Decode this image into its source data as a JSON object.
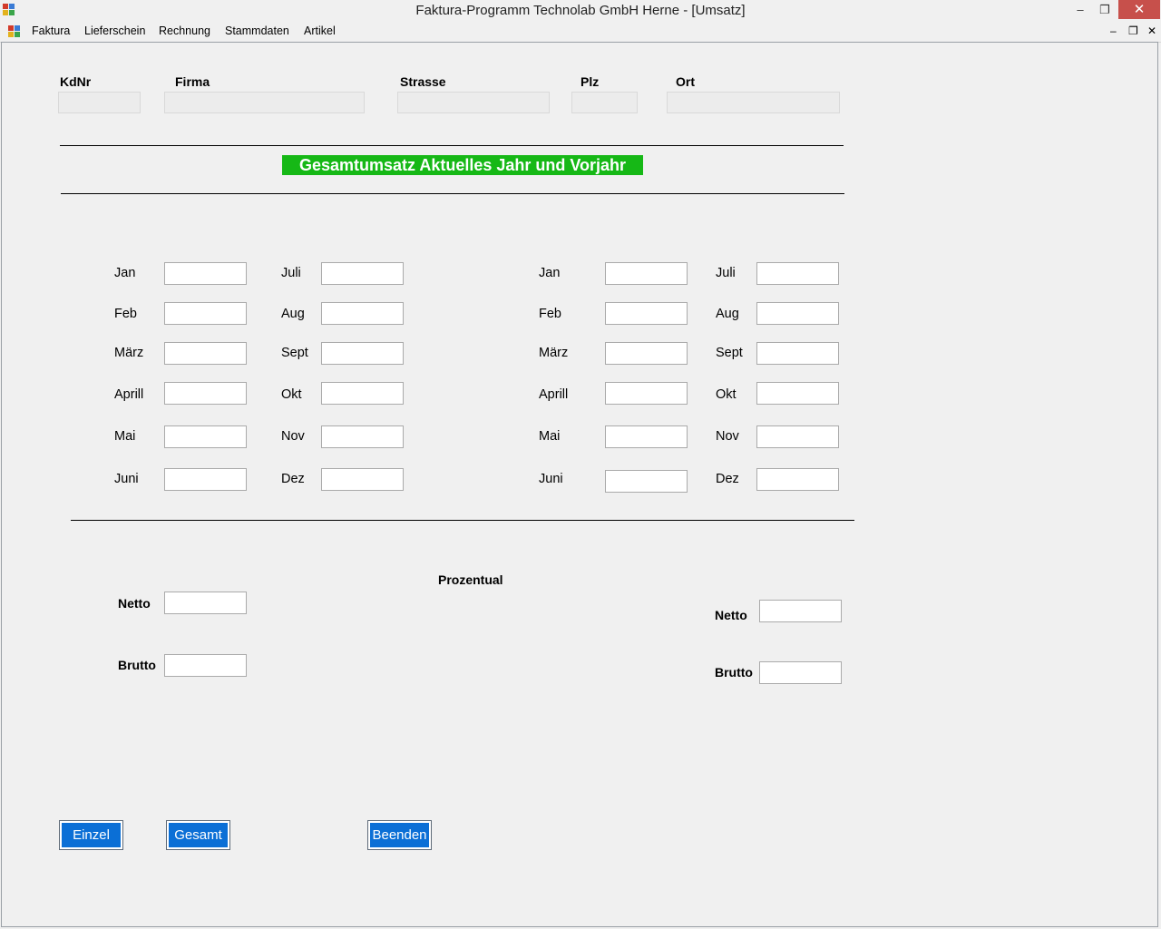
{
  "window": {
    "title": "Faktura-Programm Technolab GmbH Herne - [Umsatz]",
    "minimize": "–",
    "maximize": "❐",
    "close": "✕"
  },
  "menu": {
    "items": [
      "Faktura",
      "Lieferschein",
      "Rechnung",
      "Stammdaten",
      "Artikel"
    ],
    "mdi_minimize": "–",
    "mdi_restore": "❐",
    "mdi_close": "✕"
  },
  "header": {
    "kdnr_label": "KdNr",
    "firma_label": "Firma",
    "strasse_label": "Strasse",
    "plz_label": "Plz",
    "ort_label": "Ort"
  },
  "banner": "Gesamtumsatz Aktuelles Jahr und Vorjahr",
  "months_left": [
    "Jan",
    "Feb",
    "März",
    "Aprill",
    "Mai",
    "Juni"
  ],
  "months_right": [
    "Juli",
    "Aug",
    "Sept",
    "Okt",
    "Nov",
    "Dez"
  ],
  "prozentual_label": "Prozentual",
  "netto_label": "Netto",
  "brutto_label": "Brutto",
  "buttons": {
    "einzel": "Einzel",
    "gesamt": "Gesamt",
    "beenden": "Beenden"
  },
  "colors": {
    "banner_bg": "#16b816",
    "button_bg": "#0b6fd6",
    "close_bg": "#c7504b"
  }
}
